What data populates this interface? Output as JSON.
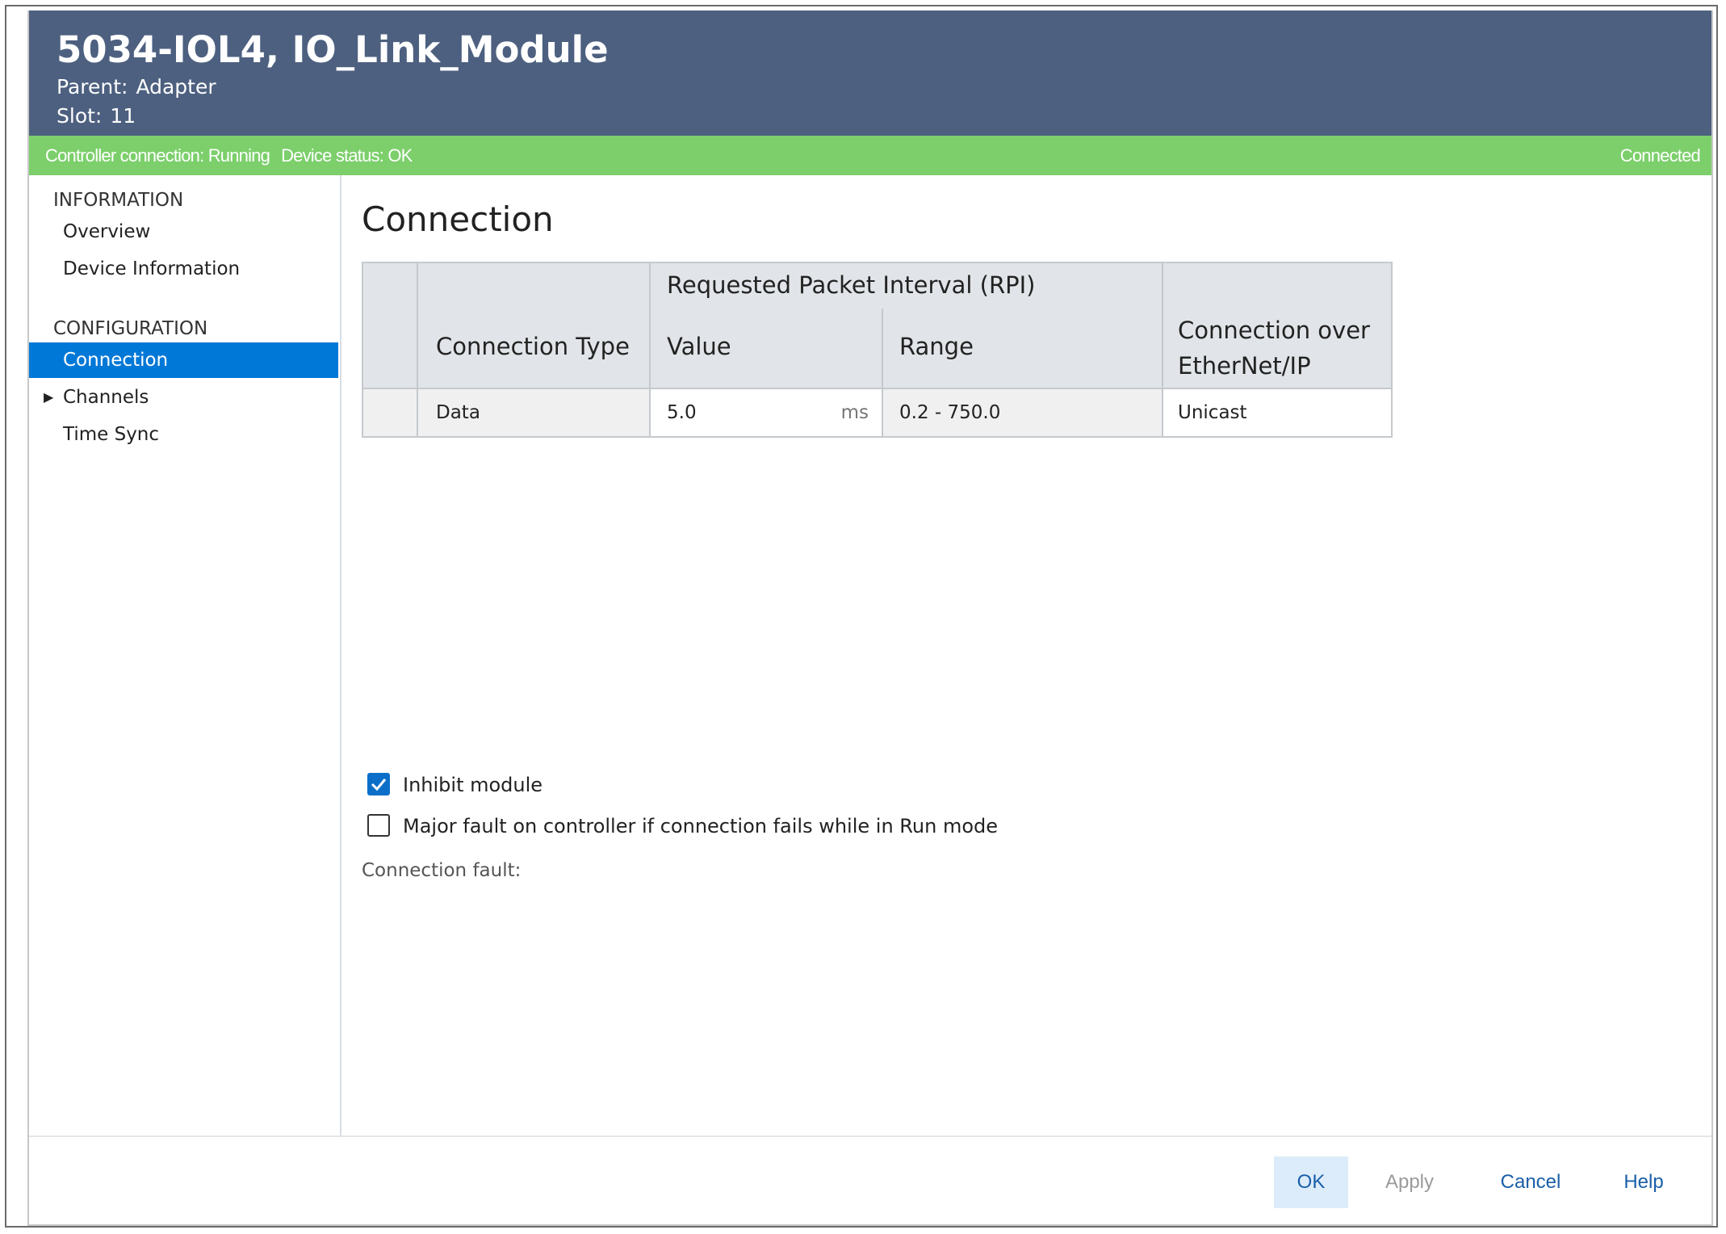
{
  "header": {
    "title": "5034-IOL4, IO_Link_Module",
    "parent_label": "Parent:",
    "parent_value": "Adapter",
    "slot_label": "Slot:",
    "slot_value": "11"
  },
  "status_bar": {
    "controller_connection": "Controller connection: Running",
    "device_status": "Device status: OK",
    "connection_state": "Connected",
    "color": "#7ccf6b"
  },
  "sidebar": {
    "sections": [
      {
        "heading": "INFORMATION",
        "items": [
          {
            "label": "Overview"
          },
          {
            "label": "Device Information"
          }
        ]
      },
      {
        "heading": "CONFIGURATION",
        "items": [
          {
            "label": "Connection",
            "selected": true
          },
          {
            "label": "Channels",
            "expandable": true
          },
          {
            "label": "Time Sync"
          }
        ]
      }
    ]
  },
  "main": {
    "title": "Connection",
    "table": {
      "headers": {
        "connection_type": "Connection Type",
        "rpi": "Requested Packet Interval (RPI)",
        "value": "Value",
        "range": "Range",
        "connection_over_line1": "Connection over",
        "connection_over_line2": "EtherNet/IP"
      },
      "rows": [
        {
          "connection_type": "Data",
          "value": "5.0",
          "unit": "ms",
          "range": "0.2 - 750.0",
          "connection_over": "Unicast"
        }
      ]
    },
    "options": {
      "inhibit_module": {
        "label": "Inhibit module",
        "checked": true
      },
      "major_fault": {
        "label": "Major fault on controller if connection fails while in Run mode",
        "checked": false
      }
    },
    "connection_fault_label": "Connection fault:"
  },
  "footer": {
    "ok": "OK",
    "apply": "Apply",
    "cancel": "Cancel",
    "help": "Help"
  },
  "colors": {
    "header_bg": "#4d6080",
    "selected_nav": "#0078d7",
    "checkbox_checked": "#0b6fc9",
    "link": "#1a5fa8"
  }
}
